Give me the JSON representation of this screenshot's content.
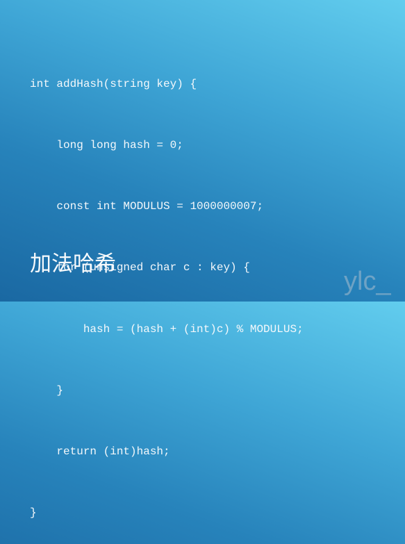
{
  "slide": {
    "code_lines": [
      "int addHash(string key) {",
      "    long long hash = 0;",
      "    const int MODULUS = 1000000007;",
      "    for (unsigned char c : key) {",
      "        hash = (hash + (int)c) % MODULUS;",
      "    }",
      "    return (int)hash;",
      "}"
    ],
    "title": "加法哈希",
    "watermark": "ylc_"
  }
}
